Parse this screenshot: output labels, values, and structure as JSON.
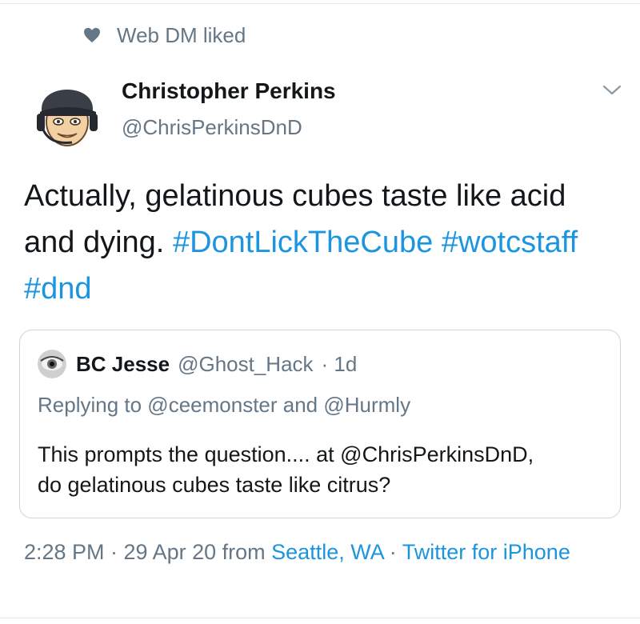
{
  "social_context": {
    "icon": "heart-icon",
    "text": "Web DM liked"
  },
  "author": {
    "name": "Christopher Perkins",
    "handle": "@ChrisPerkinsDnD"
  },
  "tweet": {
    "text_plain": "Actually, gelatinous cubes taste like acid and dying.",
    "hashtag_1": "#DontLickTheCube",
    "hashtag_2": "#wotcstaff",
    "hashtag_3": "#dnd"
  },
  "quoted_tweet": {
    "name": "BC Jesse",
    "handle": "@Ghost_Hack",
    "time": "· 1d",
    "replying_to": "Replying to @ceemonster and @Hurmly",
    "text_line1": "This prompts the question.... at @ChrisPerkinsDnD,",
    "text_line2": "do gelatinous cubes taste like citrus?"
  },
  "meta": {
    "timestamp": "2:28 PM · 29 Apr 20 from",
    "location": "Seattle, WA",
    "separator": "·",
    "source": "Twitter for iPhone"
  },
  "colors": {
    "link": "#1b95e0",
    "secondary_text": "#657786",
    "border": "#ccd6dd",
    "primary_text": "#14171a"
  }
}
